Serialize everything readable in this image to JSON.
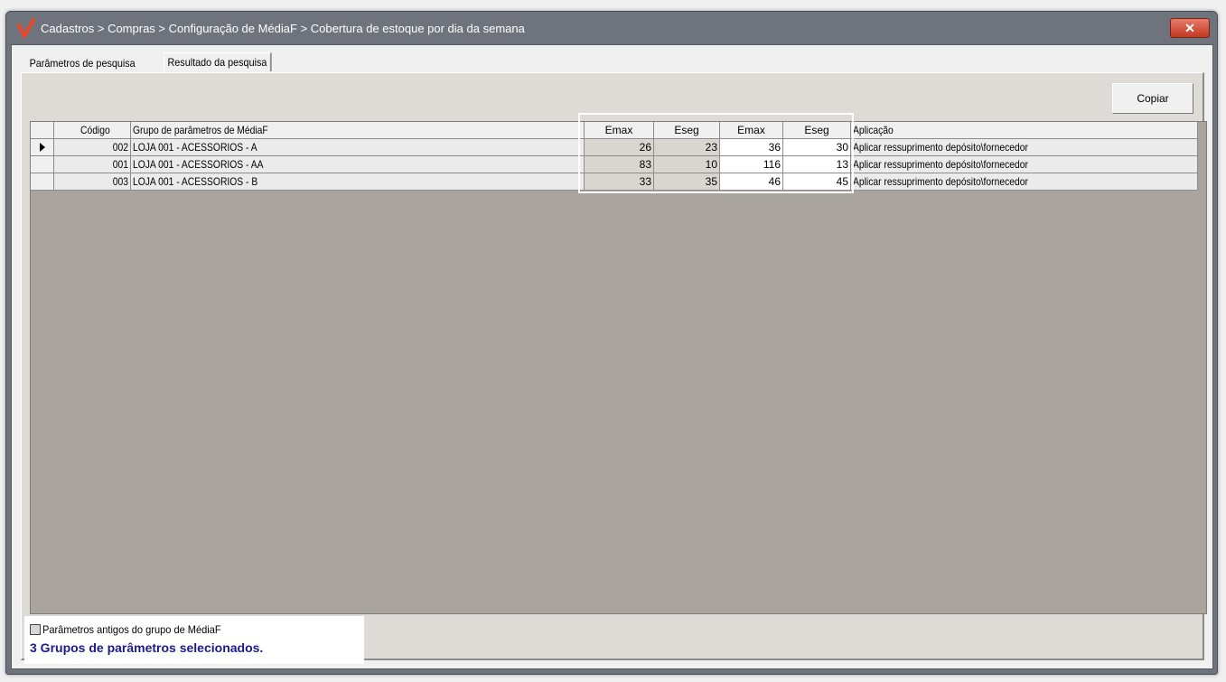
{
  "window": {
    "title": "Cadastros > Compras > Configuração de MédiaF > Cobertura de estoque por dia da semana",
    "logo_icon": "check-logo",
    "close_icon": "close-icon",
    "close_label": "✕"
  },
  "tabs": [
    {
      "label": "Parâmetros de pesquisa"
    },
    {
      "label": "Resultado da pesquisa"
    }
  ],
  "toolbar": {
    "copy_label": "Copiar"
  },
  "grid": {
    "headers": {
      "code": "Código",
      "group": "Grupo de parâmetros de MédiaF",
      "emax1": "Emax",
      "eseg1": "Eseg",
      "emax2": "Emax",
      "eseg2": "Eseg",
      "app": "Aplicação"
    },
    "rows": [
      {
        "code": "002",
        "group": "LOJA 001 - ACESSORIOS - A",
        "emax1": "26",
        "eseg1": "23",
        "emax2": "36",
        "eseg2": "30",
        "app": "Aplicar ressuprimento depósito\\fornecedor"
      },
      {
        "code": "001",
        "group": "LOJA 001 - ACESSORIOS - AA",
        "emax1": "83",
        "eseg1": "10",
        "emax2": "116",
        "eseg2": "13",
        "app": "Aplicar ressuprimento depósito\\fornecedor"
      },
      {
        "code": "003",
        "group": "LOJA 001 - ACESSORIOS - B",
        "emax1": "33",
        "eseg1": "35",
        "emax2": "46",
        "eseg2": "45",
        "app": "Aplicar ressuprimento depósito\\fornecedor"
      }
    ]
  },
  "footer": {
    "checkbox_label": "Parâmetros antigos do grupo de MédiaF",
    "checkbox_checked": false,
    "status": "3 Grupos de parâmetros selecionados."
  },
  "colors": {
    "titlebar": "#6f747c",
    "status_text": "#1a1a8c",
    "grid_empty": "#a9a49d",
    "close_button": "#c23a22"
  }
}
